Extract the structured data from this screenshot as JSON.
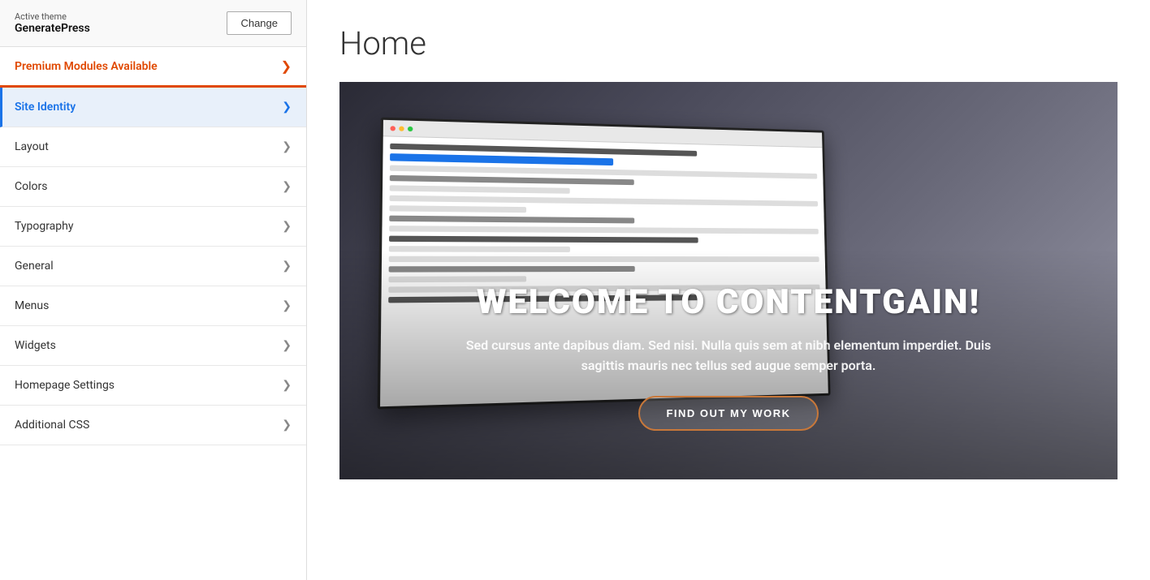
{
  "active_theme": {
    "label": "Active theme",
    "name": "GeneratePress",
    "change_button": "Change"
  },
  "sidebar": {
    "premium_banner": {
      "text": "Premium Modules Available",
      "chevron": "❯"
    },
    "items": [
      {
        "id": "site-identity",
        "label": "Site Identity",
        "active": true,
        "chevron": "❯"
      },
      {
        "id": "layout",
        "label": "Layout",
        "active": false,
        "chevron": "❯"
      },
      {
        "id": "colors",
        "label": "Colors",
        "active": false,
        "chevron": "❯"
      },
      {
        "id": "typography",
        "label": "Typography",
        "active": false,
        "chevron": "❯"
      },
      {
        "id": "general",
        "label": "General",
        "active": false,
        "chevron": "❯"
      },
      {
        "id": "menus",
        "label": "Menus",
        "active": false,
        "chevron": "❯"
      },
      {
        "id": "widgets",
        "label": "Widgets",
        "active": false,
        "chevron": "❯"
      },
      {
        "id": "homepage-settings",
        "label": "Homepage Settings",
        "active": false,
        "chevron": "❯"
      },
      {
        "id": "additional-css",
        "label": "Additional CSS",
        "active": false,
        "chevron": "❯"
      }
    ]
  },
  "main": {
    "page_title": "Home",
    "hero": {
      "headline": "WELCOME TO CONTENTGAIN!",
      "subtext": "Sed cursus ante dapibus diam. Sed nisi. Nulla quis sem at nibh elementum imperdiet. Duis sagittis mauris nec tellus sed augue semper porta.",
      "cta_label": "FIND OUT MY WORK"
    }
  }
}
